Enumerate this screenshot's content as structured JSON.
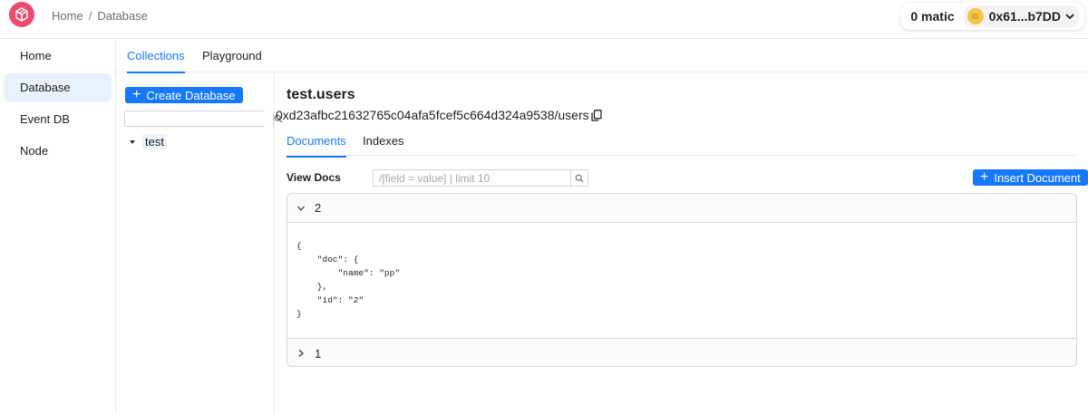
{
  "header": {
    "breadcrumb": [
      "Home",
      "/",
      "Database"
    ],
    "balance": "0 matic",
    "address": "0x61...b7DD",
    "avatar_emoji": "☺"
  },
  "sidenav": {
    "items": [
      {
        "label": "Home"
      },
      {
        "label": "Database",
        "active": true
      },
      {
        "label": "Event DB"
      },
      {
        "label": "Node"
      }
    ]
  },
  "top_tabs": [
    "Collections",
    "Playground"
  ],
  "collections": {
    "create_label": "Create Database",
    "search_placeholder": "",
    "tree": [
      {
        "label": "test"
      }
    ]
  },
  "detail": {
    "title": "test.users",
    "path": "0xd23afbc21632765c04afa5fcef5c664d324a9538/users",
    "tabs": [
      "Documents",
      "Indexes"
    ],
    "view_label": "View Docs",
    "query_placeholder": "/[field = value] | limit 10",
    "insert_label": "Insert Document",
    "docs": [
      {
        "id": "2",
        "expanded": true,
        "json": "{\n    \"doc\": {\n        \"name\": \"pp\"\n    },\n    \"id\": \"2\"\n}"
      },
      {
        "id": "1",
        "expanded": false
      }
    ]
  },
  "colors": {
    "accent": "#1677ff",
    "active_nav_bg": "#e8f2ff",
    "logo": "#ec4d6e"
  }
}
